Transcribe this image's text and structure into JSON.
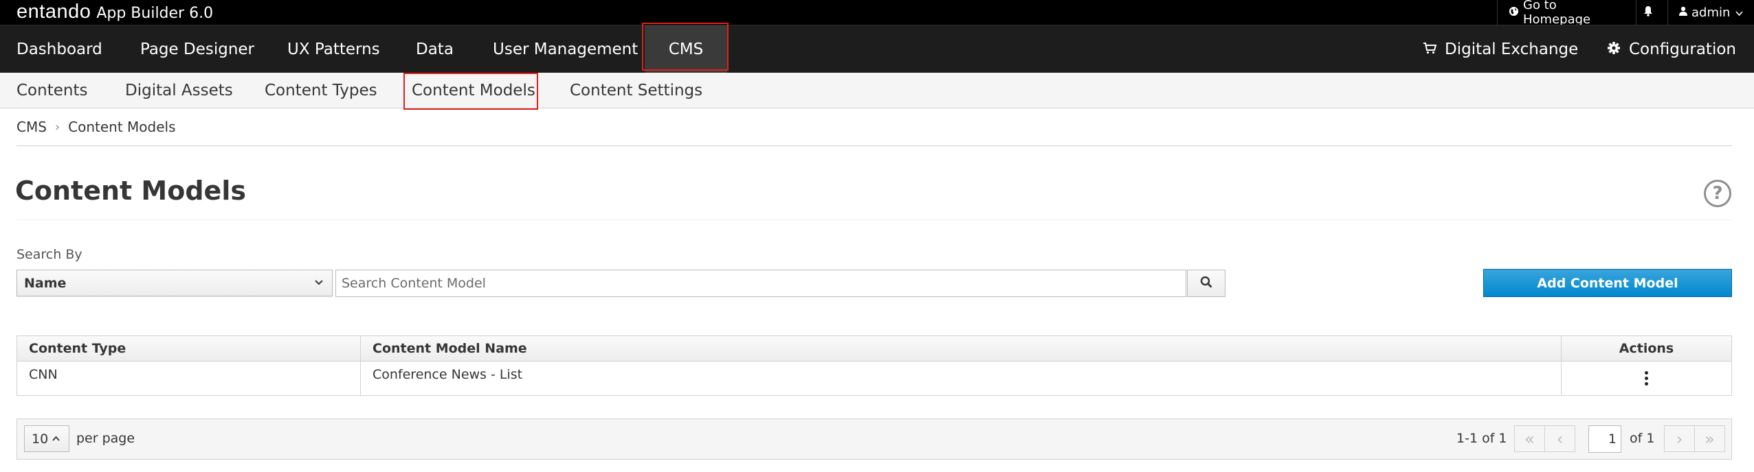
{
  "topbar": {
    "brand_logo": "entando",
    "brand_app": "App Builder 6.0",
    "go_home_label": "Go to Homepage",
    "user_label": "admin"
  },
  "main_nav": {
    "items": [
      {
        "label": "Dashboard"
      },
      {
        "label": "Page Designer"
      },
      {
        "label": "UX Patterns"
      },
      {
        "label": "Data"
      },
      {
        "label": "User Management"
      },
      {
        "label": "CMS",
        "active": true
      }
    ],
    "right": [
      {
        "label": "Digital Exchange",
        "icon": "cart-icon"
      },
      {
        "label": "Configuration",
        "icon": "gear-icon"
      }
    ]
  },
  "sub_nav": {
    "items": [
      {
        "label": "Contents"
      },
      {
        "label": "Digital Assets"
      },
      {
        "label": "Content Types"
      },
      {
        "label": "Content Models",
        "highlighted": true
      },
      {
        "label": "Content Settings"
      }
    ]
  },
  "breadcrumb": [
    "CMS",
    "Content Models"
  ],
  "page": {
    "title": "Content Models"
  },
  "search": {
    "label": "Search By",
    "selected_field": "Name",
    "placeholder": "Search Content Model",
    "value": ""
  },
  "add_button_label": "Add Content Model",
  "table": {
    "columns": [
      "Content Type",
      "Content Model Name",
      "Actions"
    ],
    "rows": [
      {
        "content_type": "CNN",
        "model_name": "Conference News - List"
      }
    ]
  },
  "pagination": {
    "per_page": "10",
    "per_page_label": "per page",
    "range": "1-1 of 1",
    "current_page": "1",
    "of_pages": "of 1"
  },
  "colors": {
    "primary_button": "#0088ce",
    "highlight_box": "#e0211a",
    "nav_background": "#1d1d1d",
    "topbar_background": "#000000"
  }
}
